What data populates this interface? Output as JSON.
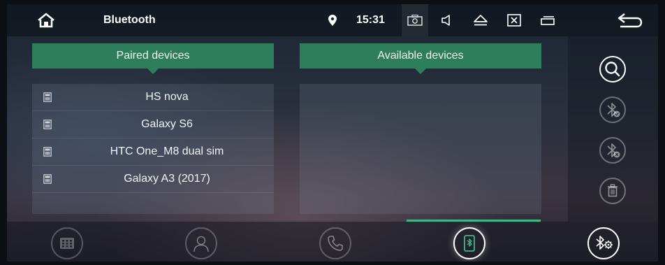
{
  "status_bar": {
    "title": "Bluetooth",
    "time": "15:31",
    "icons": [
      "home-icon",
      "location-pin-icon",
      "camera-icon",
      "volume-icon",
      "eject-icon",
      "close-box-icon",
      "window-icon",
      "back-icon"
    ]
  },
  "paired_panel": {
    "header": "Paired devices",
    "devices": [
      {
        "name": "HS nova",
        "icon": "phone-icon"
      },
      {
        "name": "Galaxy S6",
        "icon": "phone-icon"
      },
      {
        "name": "HTC One_M8 dual sim",
        "icon": "phone-icon"
      },
      {
        "name": "Galaxy A3 (2017)",
        "icon": "phone-icon"
      }
    ]
  },
  "available_panel": {
    "header": "Available devices",
    "devices": []
  },
  "right_rail": {
    "buttons": [
      "search-icon",
      "bluetooth-connect-icon",
      "bluetooth-disconnect-icon",
      "trash-icon"
    ]
  },
  "bottom_nav": {
    "items": [
      "dialpad-icon",
      "contacts-icon",
      "call-icon",
      "bluetooth-phone-icon",
      "bluetooth-settings-icon"
    ],
    "active": "bluetooth-phone-icon"
  },
  "colors": {
    "accent": "#2e7d5d",
    "active_indicator": "#3fb889"
  }
}
